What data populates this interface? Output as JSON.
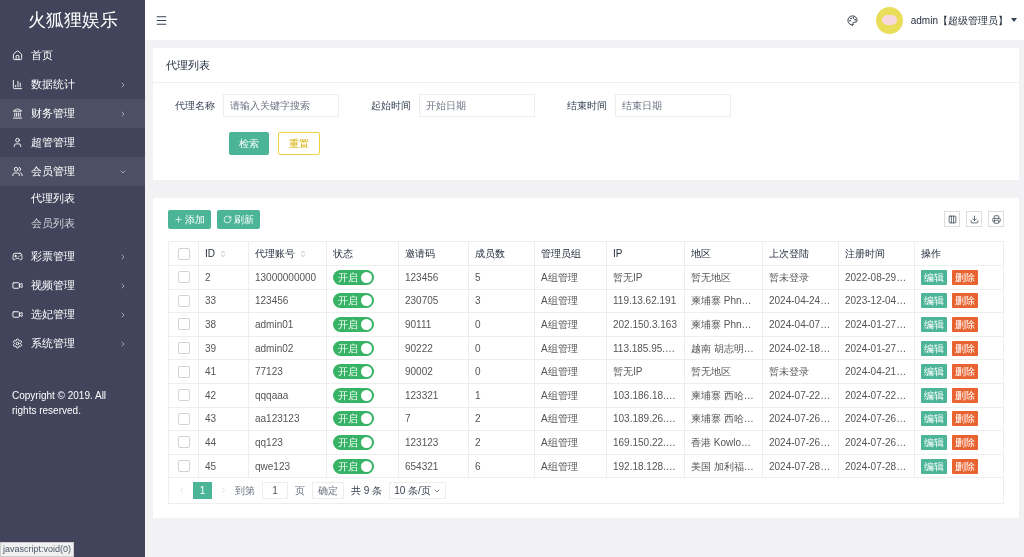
{
  "sidebar": {
    "logo": "火狐狸娱乐",
    "items": [
      {
        "label": "首页",
        "kind": "link",
        "highlighted": false
      },
      {
        "label": "数据统计",
        "kind": "menu",
        "expanded": false,
        "highlighted": false
      },
      {
        "label": "财务管理",
        "kind": "menu",
        "expanded": false,
        "highlighted": true
      },
      {
        "label": "超管管理",
        "kind": "link",
        "highlighted": false
      },
      {
        "label": "会员管理",
        "kind": "menu",
        "expanded": true,
        "highlighted": true,
        "children": [
          {
            "label": "代理列表",
            "selected": true
          },
          {
            "label": "会员列表",
            "selected": false
          }
        ]
      },
      {
        "label": "彩票管理",
        "kind": "menu",
        "expanded": false,
        "highlighted": false
      },
      {
        "label": "视频管理",
        "kind": "menu",
        "expanded": false,
        "highlighted": false
      },
      {
        "label": "选妃管理",
        "kind": "menu",
        "expanded": false,
        "highlighted": false
      },
      {
        "label": "系统管理",
        "kind": "menu",
        "expanded": false,
        "highlighted": false
      }
    ],
    "copyright": "Copyright © 2019. All rights reserved."
  },
  "header": {
    "user": "admin【超级管理员】"
  },
  "filter": {
    "title": "代理列表",
    "fields": [
      {
        "label": "代理名称",
        "placeholder": "请输入关键字搜索"
      },
      {
        "label": "起始时间",
        "placeholder": "开始日期"
      },
      {
        "label": "结束时间",
        "placeholder": "结束日期"
      }
    ],
    "search_button": "检索",
    "reset_button": "重置"
  },
  "toolbar": {
    "add_button": "添加",
    "refresh_button": "刷新"
  },
  "table": {
    "select_all_checked": false,
    "columns": [
      {
        "label": "ID",
        "sortable": true
      },
      {
        "label": "代理账号",
        "sortable": true
      },
      {
        "label": "状态",
        "sortable": false
      },
      {
        "label": "邀请码",
        "sortable": false
      },
      {
        "label": "成员数",
        "sortable": false
      },
      {
        "label": "管理员组",
        "sortable": false
      },
      {
        "label": "IP",
        "sortable": false
      },
      {
        "label": "地区",
        "sortable": false
      },
      {
        "label": "上次登陆",
        "sortable": false
      },
      {
        "label": "注册时间",
        "sortable": false
      },
      {
        "label": "操作",
        "sortable": false
      }
    ],
    "rows": [
      {
        "checked": false,
        "cells": [
          "2",
          "13000000000",
          {
            "label": "开启",
            "on": true
          },
          "123456",
          "5",
          "A组管理",
          "暂无IP",
          "暂无地区",
          "暂未登录",
          "2022-08-29…",
          [
            "编辑",
            "删除"
          ]
        ]
      },
      {
        "checked": false,
        "cells": [
          "33",
          "123456",
          {
            "label": "开启",
            "on": true
          },
          "230705",
          "3",
          "A组管理",
          "119.13.62.191",
          "柬埔寨 Phn…",
          "2024-04-24…",
          "2023-12-04…",
          [
            "编辑",
            "删除"
          ]
        ]
      },
      {
        "checked": false,
        "cells": [
          "38",
          "admin01",
          {
            "label": "开启",
            "on": true
          },
          "90111",
          "0",
          "A组管理",
          "202.150.3.163",
          "柬埔寨 Phn…",
          "2024-04-07…",
          "2024-01-27…",
          [
            "编辑",
            "删除"
          ]
        ]
      },
      {
        "checked": false,
        "cells": [
          "39",
          "admin02",
          {
            "label": "开启",
            "on": true
          },
          "90222",
          "0",
          "A组管理",
          "113.185.95.…",
          "越南 胡志明…",
          "2024-02-18…",
          "2024-01-27…",
          [
            "编辑",
            "删除"
          ]
        ]
      },
      {
        "checked": false,
        "cells": [
          "41",
          "77123",
          {
            "label": "开启",
            "on": true
          },
          "90002",
          "0",
          "A组管理",
          "暂无IP",
          "暂无地区",
          "暂未登录",
          "2024-04-21…",
          [
            "编辑",
            "删除"
          ]
        ]
      },
      {
        "checked": false,
        "cells": [
          "42",
          "qqqaaa",
          {
            "label": "开启",
            "on": true
          },
          "123321",
          "1",
          "A组管理",
          "103.186.18.…",
          "柬埔寨 西哈…",
          "2024-07-22…",
          "2024-07-22…",
          [
            "编辑",
            "删除"
          ]
        ]
      },
      {
        "checked": false,
        "cells": [
          "43",
          "aa123123",
          {
            "label": "开启",
            "on": true
          },
          "7",
          "2",
          "A组管理",
          "103.189.26.…",
          "柬埔寨 西哈…",
          "2024-07-26…",
          "2024-07-26…",
          [
            "编辑",
            "删除"
          ]
        ]
      },
      {
        "checked": false,
        "cells": [
          "44",
          "qq123",
          {
            "label": "开启",
            "on": true
          },
          "123123",
          "2",
          "A组管理",
          "169.150.22.…",
          "香港 Kowlo…",
          "2024-07-26…",
          "2024-07-26…",
          [
            "编辑",
            "删除"
          ]
        ]
      },
      {
        "checked": false,
        "cells": [
          "45",
          "qwe123",
          {
            "label": "开启",
            "on": true
          },
          "654321",
          "6",
          "A组管理",
          "192.18.128.…",
          "美国 加利福…",
          "2024-07-28…",
          "2024-07-28…",
          [
            "编辑",
            "删除"
          ]
        ]
      }
    ]
  },
  "pagination": {
    "pages": [
      {
        "label": "1",
        "selected": true
      }
    ],
    "goto_label": "到第",
    "goto_value": "1",
    "page_unit": "页",
    "confirm_button": "确定",
    "total": "共 9 条",
    "page_size": "10 条/页"
  },
  "status_bar": "javascript:void(0)"
}
